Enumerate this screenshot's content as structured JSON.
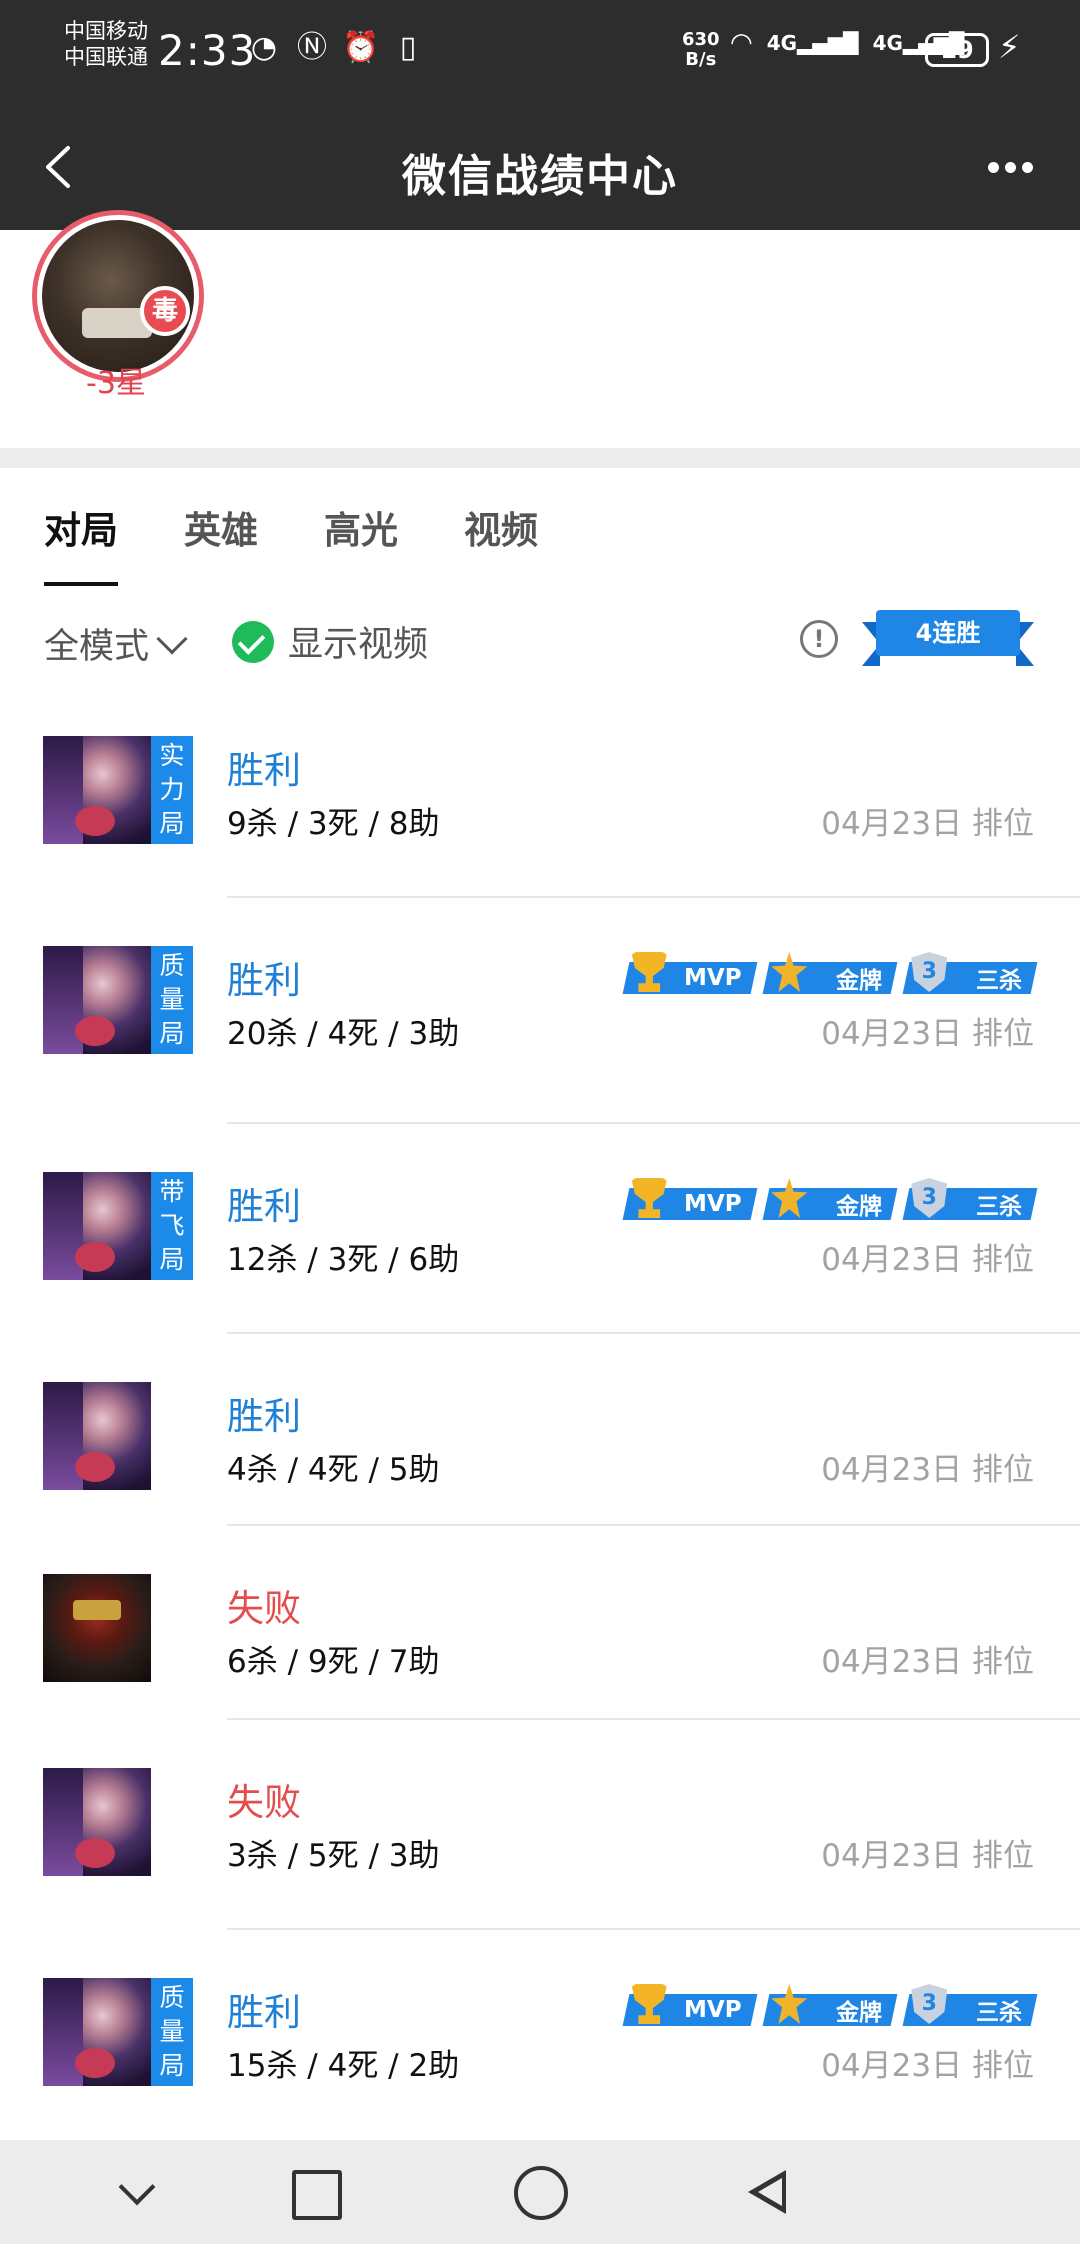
{
  "status_bar": {
    "carrier_1": "中国移动",
    "carrier_2": "中国联通",
    "time": "2:33",
    "net_speed_value": "630",
    "net_speed_unit": "B/s",
    "network_1": "4G",
    "network_2": "4G",
    "battery": "19"
  },
  "title_bar": {
    "title": "微信战绩中心"
  },
  "profile": {
    "badge_text": "毒",
    "star_change": "-3星"
  },
  "tabs": [
    {
      "label": "对局",
      "active": true
    },
    {
      "label": "英雄",
      "active": false
    },
    {
      "label": "高光",
      "active": false
    },
    {
      "label": "视频",
      "active": false
    }
  ],
  "filter": {
    "mode_label": "全模式",
    "show_video_label": "显示视频",
    "show_video_checked": true,
    "info_glyph": "!",
    "streak_label": "4连胜"
  },
  "badge_labels": {
    "mvp": "MVP",
    "gold": "金牌",
    "triple": "三杀",
    "triple_glyph": "3"
  },
  "matches": [
    {
      "result": "胜利",
      "outcome": "win",
      "kda": "9杀 / 3死 / 8助",
      "date": "04月23日",
      "type": "排位",
      "tag": [
        "实",
        "力",
        "局"
      ],
      "hero": "girl",
      "badges": false
    },
    {
      "result": "胜利",
      "outcome": "win",
      "kda": "20杀 / 4死 / 3助",
      "date": "04月23日",
      "type": "排位",
      "tag": [
        "质",
        "量",
        "局"
      ],
      "hero": "girl",
      "badges": true
    },
    {
      "result": "胜利",
      "outcome": "win",
      "kda": "12杀 / 3死 / 6助",
      "date": "04月23日",
      "type": "排位",
      "tag": [
        "带",
        "飞",
        "局"
      ],
      "hero": "girl",
      "badges": true
    },
    {
      "result": "胜利",
      "outcome": "win",
      "kda": "4杀 / 4死 / 5助",
      "date": "04月23日",
      "type": "排位",
      "tag": null,
      "hero": "girl",
      "badges": false
    },
    {
      "result": "失败",
      "outcome": "loss",
      "kda": "6杀 / 9死 / 7助",
      "date": "04月23日",
      "type": "排位",
      "tag": null,
      "hero": "warrior",
      "badges": false
    },
    {
      "result": "失败",
      "outcome": "loss",
      "kda": "3杀 / 5死 / 3助",
      "date": "04月23日",
      "type": "排位",
      "tag": null,
      "hero": "girl",
      "badges": false
    },
    {
      "result": "胜利",
      "outcome": "win",
      "kda": "15杀 / 4死 / 2助",
      "date": "04月23日",
      "type": "排位",
      "tag": [
        "质",
        "量",
        "局"
      ],
      "hero": "girl",
      "badges": true
    }
  ]
}
